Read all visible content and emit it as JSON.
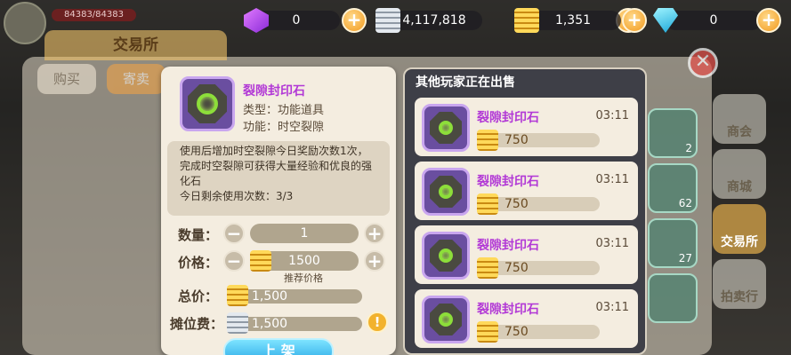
{
  "player": {
    "hp": "84383/84383"
  },
  "currencies": [
    {
      "icon": "purple-gem-icon",
      "value": "0"
    },
    {
      "icon": "silver-coin-icon",
      "value": "4,117,818"
    },
    {
      "icon": "gold-coin-icon",
      "value": "1,351"
    },
    {
      "icon": "diamond-icon",
      "value": "0"
    }
  ],
  "trade": {
    "title": "交易所",
    "tabs": {
      "buy": "购买",
      "sell": "寄卖"
    }
  },
  "side_menu": [
    {
      "label": "商会"
    },
    {
      "label": "商城"
    },
    {
      "label": "交易所"
    },
    {
      "label": "拍卖行"
    }
  ],
  "slots": [
    {
      "count": "2"
    },
    {
      "count": "62"
    },
    {
      "count": "27"
    }
  ],
  "item": {
    "name": "裂隙封印石",
    "type": "类型：功能道具",
    "function": "功能：时空裂隙",
    "description": "使用后增加时空裂隙今日奖励次数1次，完成时空裂隙可获得大量经验和优良的强化石",
    "uses_left": "今日剩余使用次数：3/3"
  },
  "form": {
    "quantity_label": "数量：",
    "quantity": "1",
    "price_label": "价格：",
    "price": "1500",
    "price_hint": "推荐价格",
    "total_label": "总价：",
    "total": "1,500",
    "fee_label": "摊位费：",
    "fee": "1,500",
    "submit": "上 架"
  },
  "listing": {
    "title": "其他玩家正在出售",
    "items": [
      {
        "name": "裂隙封印石",
        "time": "03:11",
        "price": "750"
      },
      {
        "name": "裂隙封印石",
        "time": "03:11",
        "price": "750"
      },
      {
        "name": "裂隙封印石",
        "time": "03:11",
        "price": "750"
      },
      {
        "name": "裂隙封印石",
        "time": "03:11",
        "price": "750"
      }
    ]
  }
}
